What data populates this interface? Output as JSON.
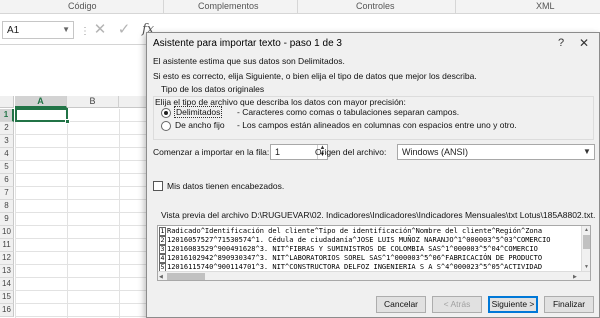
{
  "ribbon": {
    "groups": [
      "Código",
      "Complementos",
      "Controles",
      "XML"
    ]
  },
  "formula_bar": {
    "name_box": "A1",
    "dots": "⋮",
    "cancel_icon": "✕",
    "enter_icon": "✓",
    "fx_label": "fx"
  },
  "grid": {
    "columns": [
      "A",
      "B"
    ],
    "selected_column": "A",
    "rows": [
      "1",
      "2",
      "3",
      "4",
      "5",
      "6",
      "7",
      "8",
      "9",
      "10",
      "11",
      "12",
      "13",
      "14",
      "15",
      "16"
    ],
    "active_cell": "A1",
    "accent_color": "#217346"
  },
  "dialog": {
    "title": "Asistente para importar texto - paso 1 de 3",
    "help": "?",
    "close": "✕",
    "line1": "El asistente estima que sus datos son Delimitados.",
    "line2": "Si esto es correcto, elija Siguiente, o bien elija el tipo de datos que mejor los describa.",
    "group_title": "Tipo de los datos originales",
    "group_prompt": "Elija el tipo de archivo que describa los datos con mayor precisión:",
    "options": [
      {
        "label": "Delimitados",
        "desc": "- Caracteres como comas o tabulaciones separan campos.",
        "selected": true
      },
      {
        "label": "De ancho fijo",
        "desc": "- Los campos están alineados en columnas con espacios entre uno y otro.",
        "selected": false
      }
    ],
    "start_row_label": "Comenzar a importar en la fila:",
    "start_row_value": "1",
    "origin_label": "Origen del archivo:",
    "origin_value": "Windows (ANSI)",
    "headers_label": "Mis datos tienen encabezados.",
    "headers_checked": false,
    "preview_label": "Vista previa del archivo D:\\RUGUEVAR\\02. Indicadores\\Indicadores\\Indicadores Mensuales\\txt Lotus\\185A8802.txt.",
    "preview_rows": [
      {
        "num": "1",
        "text": "Radicado^Identificación del cliente^Tipo de identificación^Nombre del cliente^Región^Zona"
      },
      {
        "num": "2",
        "text": "12016057527^71530574^1. Cédula de ciudadanía^JOSE LUIS MUÑOZ NARANJO^1^000003^5^03^COMERCIO"
      },
      {
        "num": "3",
        "text": "12016083529^900491628^3. NIT^FIBRAS Y SUMINISTROS DE COLOMBIA SAS^1^000003^5^04^COMERCIO"
      },
      {
        "num": "4",
        "text": "12016102942^890930347^3. NIT^LABORATORIOS SOREL SAS^1^000003^5^06^FABRICACIÓN DE PRODUCTO"
      },
      {
        "num": "5",
        "text": "12016115740^900114701^3. NIT^CONSTRUCTORA DELFOZ INGENIERIA S A S^4^000023^5^05^ACTIVIDAD"
      }
    ],
    "buttons": {
      "cancel": "Cancelar",
      "back": "< Atrás",
      "next": "Siguiente >",
      "finish": "Finalizar"
    }
  }
}
